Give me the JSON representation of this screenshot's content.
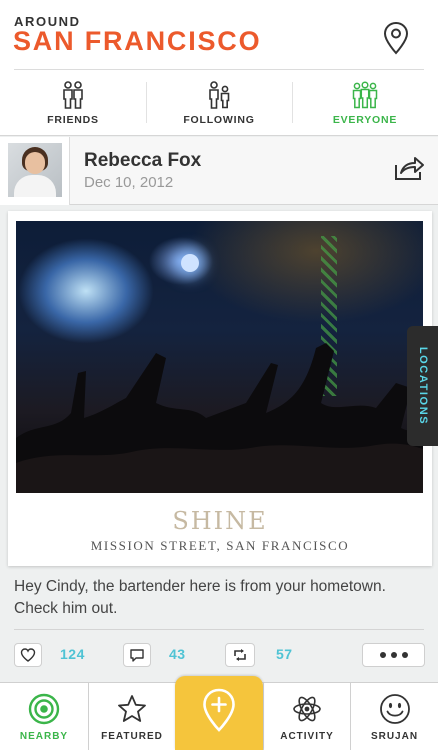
{
  "header": {
    "around_label": "AROUND",
    "city": "SAN FRANCISCO",
    "location_icon": "map-pin-icon",
    "accent_color": "#ec5a2c"
  },
  "filters": [
    {
      "label": "FRIENDS",
      "icon": "friends-icon",
      "active": false
    },
    {
      "label": "FOLLOWING",
      "icon": "following-icon",
      "active": false
    },
    {
      "label": "EVERYONE",
      "icon": "everyone-icon",
      "active": true
    }
  ],
  "post": {
    "user_name": "Rebecca Fox",
    "date": "Dec 10, 2012",
    "share_icon": "share-icon",
    "place_name": "SHINE",
    "place_address": "MISSION STREET, SAN FRANCISCO",
    "text": "Hey Cindy, the bartender here is from your hometown. Check him out.",
    "likes": "124",
    "comments": "43",
    "reposts": "57"
  },
  "side_tab": {
    "label": "LOCATIONS"
  },
  "bottom_nav": [
    {
      "label": "NEARBY",
      "icon": "nearby-target-icon",
      "active": true
    },
    {
      "label": "FEATURED",
      "icon": "star-icon",
      "active": false
    },
    {
      "label": "",
      "icon": "add-pin-icon",
      "active": false
    },
    {
      "label": "ACTIVITY",
      "icon": "atom-icon",
      "active": false
    },
    {
      "label": "SRUJAN",
      "icon": "smiley-icon",
      "active": false
    }
  ],
  "colors": {
    "active_green": "#3bb54a",
    "count_cyan": "#4fc3d4",
    "center_yellow": "#f5c53c"
  }
}
